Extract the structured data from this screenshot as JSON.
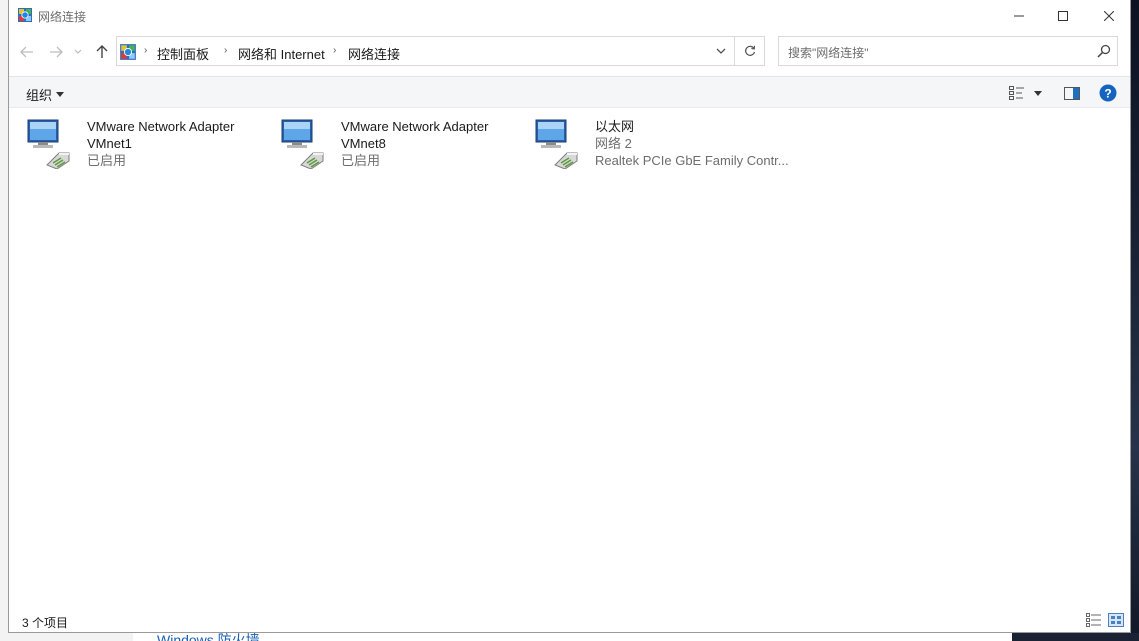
{
  "window": {
    "title": "网络连接",
    "controls": {
      "minimize": "minimize",
      "maximize": "maximize",
      "close": "close"
    }
  },
  "nav": {
    "breadcrumbs": [
      "控制面板",
      "网络和 Internet",
      "网络连接"
    ],
    "search_placeholder": "搜索\"网络连接\""
  },
  "commandbar": {
    "organize_label": "组织"
  },
  "items": [
    {
      "name": "VMware Network Adapter",
      "sub": "VMnet1",
      "status": "已启用",
      "icon": "network-adapter-icon"
    },
    {
      "name": "VMware Network Adapter",
      "sub": "VMnet8",
      "status": "已启用",
      "icon": "network-adapter-icon"
    },
    {
      "name": "以太网",
      "sub": "网络 2",
      "status": "Realtek PCIe GbE Family Contr...",
      "icon": "network-adapter-icon"
    }
  ],
  "statusbar": {
    "count": "3 个项目"
  },
  "background": {
    "link_text": "Windows 防火墙"
  },
  "colors": {
    "accent": "#1a5fb4",
    "help_blue": "#1565c0",
    "muted_text": "#6d6d6d"
  }
}
